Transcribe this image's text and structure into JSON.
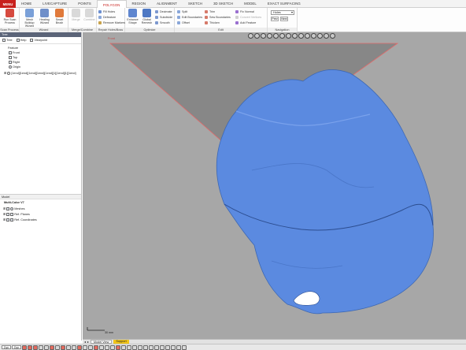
{
  "menu": {
    "app_button": "MENU",
    "tabs": [
      "HOME",
      "LIVECAPTURE",
      "POINTS",
      "POLYGON",
      "REGION",
      "ALIGNMENT",
      "SKETCH",
      "3D SKETCH",
      "MODEL",
      "EXACT SURFACING"
    ],
    "active_tab": "POLYGON"
  },
  "ribbon": {
    "groups": {
      "scan_process": "Scan Process",
      "wizard": "Wizard",
      "merge_combine": "Merge/Combine",
      "repair": "Repair Holes/Boss",
      "optimize": "Optimize",
      "edit": "Edit",
      "navigation": "Navigation"
    },
    "buttons": {
      "run_scan_process": "Run Scan Process",
      "mesh_buildup_wizard": "Mesh Buildup Wizard",
      "healing_wizard": "Healing Wizard",
      "smart_brush": "Smart Brush",
      "merge": "Merge",
      "combine": "Combine",
      "fill_holes": "Fill Holes",
      "defeature": "Defeature",
      "remove_markers": "Remove Markers",
      "enhance_shape": "Enhance Shape",
      "global_remesh": "Global Remesh",
      "decimate": "Decimate",
      "subdivide": "Subdivide",
      "smooth": "Smooth",
      "split": "Split",
      "edit_boundaries": "Edit Boundaries",
      "offset": "Offset",
      "trim": "Trim",
      "sew_boundaries": "Sew Boundaries",
      "thicken": "Thicken",
      "fix_normal": "Fix Normal",
      "convert_vertices": "Convert Vertices",
      "add_feature": "Add Feature"
    },
    "navigation": {
      "selected": "Holes",
      "prev": "Prev",
      "next": "Next"
    }
  },
  "left_panel": {
    "title": "Tree",
    "toolbar": {
      "tree": "Tree",
      "help": "Help",
      "viewpoint": "Viewpoint"
    },
    "feature_header": "Feature",
    "features": [
      "Front",
      "Top",
      "Right",
      "Origin",
      "[1end][1end][1end][1end][1end][1][1end][1][1end]"
    ],
    "model_header": "Model",
    "model_root": "Multi-Color V7",
    "model_items": [
      "Meshes",
      "Ref. Planes",
      "Ref. Coordinates"
    ]
  },
  "viewport": {
    "plane_label": "Front",
    "scale_label": "30 mm",
    "colors": {
      "background": "#a7a7a7",
      "mesh": "#5b8ae0",
      "plane": "#878787",
      "plane_edge": "#e06a6a"
    }
  },
  "view_tabs": [
    "Model View",
    "Support"
  ],
  "status_bar": {
    "left_box": "Dyn",
    "right_box": "Dyn"
  }
}
